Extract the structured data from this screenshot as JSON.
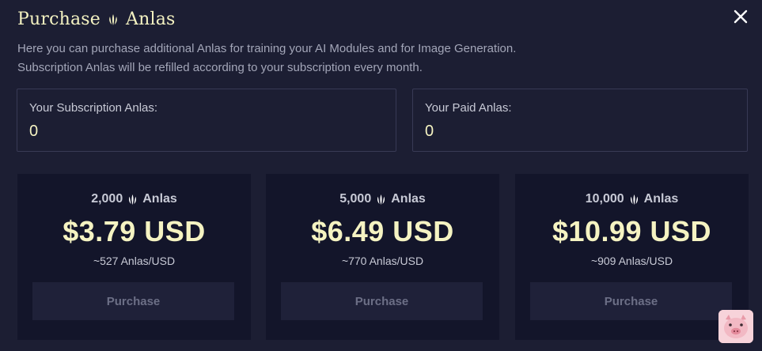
{
  "modal": {
    "title_prefix": "Purchase",
    "title_suffix": "Anlas",
    "description_line1": "Here you can purchase additional Anlas for training your AI Modules and for Image Generation.",
    "description_line2": "Subscription Anlas will be refilled according to your subscription every month."
  },
  "balances": {
    "subscription_label": "Your Subscription Anlas:",
    "subscription_value": "0",
    "paid_label": "Your Paid Anlas:",
    "paid_value": "0"
  },
  "packages": [
    {
      "amount": "2,000",
      "unit": "Anlas",
      "price": "$3.79 USD",
      "rate": "~527 Anlas/USD",
      "button": "Purchase"
    },
    {
      "amount": "5,000",
      "unit": "Anlas",
      "price": "$6.49 USD",
      "rate": "~770 Anlas/USD",
      "button": "Purchase"
    },
    {
      "amount": "10,000",
      "unit": "Anlas",
      "price": "$10.99 USD",
      "rate": "~909 Anlas/USD",
      "button": "Purchase"
    }
  ],
  "icons": {
    "anlas": "anlas-icon",
    "close": "close-icon",
    "mascot": "pig-icon"
  },
  "colors": {
    "background": "#1c1e33",
    "card": "#13152a",
    "accent": "#f5f3c2",
    "muted": "#a3a6b8",
    "button": "#1f2139"
  }
}
